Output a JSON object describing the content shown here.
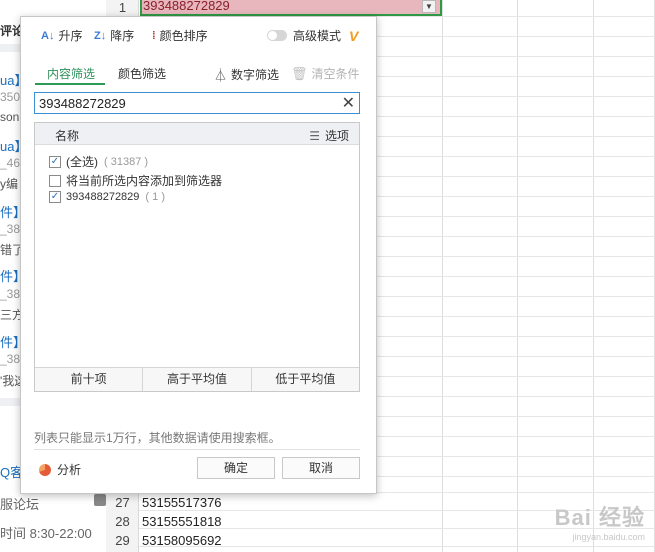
{
  "web_strip": {
    "header": "评论",
    "fragments": [
      "ua】",
      "350",
      "son",
      "ua】",
      "_46",
      "y编",
      "件】",
      "_38",
      "错了",
      "件】",
      "_38",
      "三方",
      "件】",
      "_38",
      "'我这"
    ],
    "q_text": "Q客",
    "forum": "服论坛",
    "hours": "时间 8:30-22:00"
  },
  "sheet": {
    "active_row": "1",
    "active_value": "393488272829",
    "dropdown_glyph": "▼",
    "visible_rows": [
      {
        "num": "27",
        "value": "53155517376"
      },
      {
        "num": "28",
        "value": "53155551818"
      },
      {
        "num": "29",
        "value": "53158095692"
      }
    ],
    "watermark_main": "Bai 经验",
    "watermark_sub": "jingyan.baidu.com"
  },
  "filter": {
    "toolbar": {
      "asc_label": "升序",
      "desc_label": "降序",
      "color_sort_label": "颜色排序",
      "advanced_label": "高级模式",
      "vip_badge": "V"
    },
    "tabs": {
      "content_filter": "内容筛选",
      "color_filter": "颜色筛选",
      "number_filter": "数字筛选",
      "clear_conditions": "清空条件"
    },
    "search_value": "393488272829",
    "list_header": {
      "name": "名称",
      "options": "选项"
    },
    "items": [
      {
        "label": "(全选)",
        "count": "( 31387 )",
        "checked": true
      },
      {
        "label": "将当前所选内容添加到筛选器",
        "count": "",
        "checked": false
      },
      {
        "label": "393488272829",
        "count": "( 1 )",
        "checked": true
      }
    ],
    "quick_buttons": [
      "前十项",
      "高于平均值",
      "低于平均值"
    ],
    "hint": "列表只能显示1万行，其他数据请使用搜索框。",
    "analysis_label": "分析",
    "ok_label": "确定",
    "cancel_label": "取消"
  },
  "colors": {
    "accent_green": "#2f9a55",
    "active_cell_fill": "#e7b7bd",
    "search_border": "#3a8fd6",
    "vip_orange": "#f29b1d"
  }
}
